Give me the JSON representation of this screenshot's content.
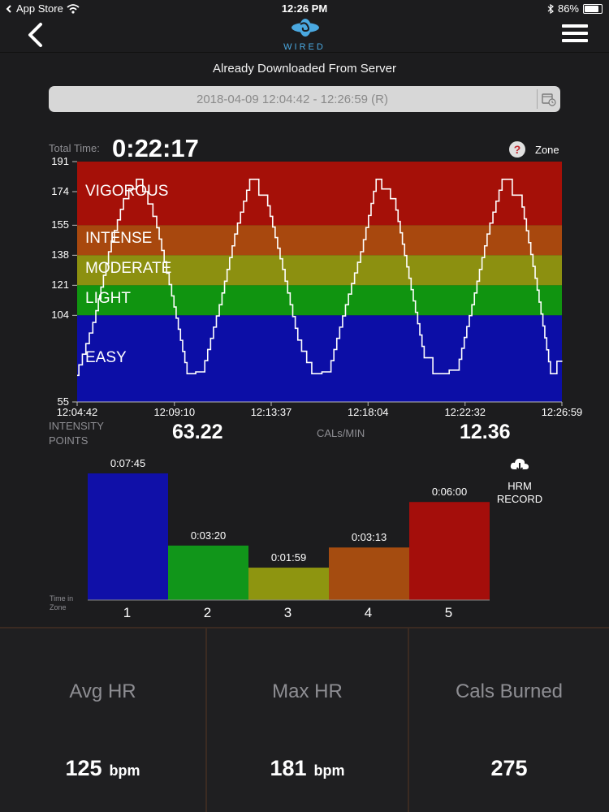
{
  "status_bar": {
    "back_app": "App Store",
    "time": "12:26 PM",
    "battery": "86%",
    "battery_level": 0.86
  },
  "nav": {
    "logo_text": "WIRED"
  },
  "session": {
    "source_note": "Already Downloaded From Server",
    "range": "2018-04-09 12:04:42 - 12:26:59 (R)",
    "total_time_label": "Total Time:",
    "total_time": "0:22:17",
    "zone_label": "Zone",
    "help_glyph": "?"
  },
  "chart_data": [
    {
      "type": "line",
      "title": "",
      "ylabel": "",
      "xlabel": "",
      "ylim": [
        55,
        191
      ],
      "y_ticks": [
        "191",
        "174",
        "155",
        "138",
        "121",
        "104",
        "55"
      ],
      "x_ticks": [
        "12:04:42",
        "12:09:10",
        "12:13:37",
        "12:18:04",
        "12:22:32",
        "12:26:59"
      ],
      "zones": [
        {
          "name": "VIGOROUS",
          "from": 155,
          "to": 191,
          "color": "#a51008"
        },
        {
          "name": "INTENSE",
          "from": 138,
          "to": 155,
          "color": "#a8480e"
        },
        {
          "name": "MODERATE",
          "from": 121,
          "to": 138,
          "color": "#8c9010"
        },
        {
          "name": "LIGHT",
          "from": 104,
          "to": 121,
          "color": "#109410"
        },
        {
          "name": "EASY",
          "from": 55,
          "to": 104,
          "color": "#0c0ea6"
        }
      ],
      "series": [
        {
          "color": "#ffffff",
          "x_minutes": [
            0,
            0.8,
            1.5,
            2.2,
            2.9,
            3.6,
            4.4,
            5.1,
            5.8,
            6.6,
            7.3,
            8.0,
            8.7,
            9.5,
            10.2,
            10.9,
            11.6,
            12.4,
            13.1,
            13.8,
            14.6,
            15.3,
            16.0,
            16.7,
            17.5,
            18.2,
            18.9,
            19.6,
            20.4,
            21.1,
            21.8,
            22.3
          ],
          "values": [
            70,
            100,
            140,
            170,
            181,
            160,
            115,
            71,
            72,
            110,
            150,
            181,
            172,
            130,
            90,
            71,
            72,
            110,
            140,
            181,
            170,
            125,
            80,
            71,
            73,
            110,
            150,
            181,
            172,
            125,
            71,
            78
          ]
        }
      ]
    },
    {
      "type": "bar",
      "title": "",
      "xlabel": "",
      "ylabel": "Time in Zone",
      "categories": [
        "1",
        "2",
        "3",
        "4",
        "5"
      ],
      "value_labels": [
        "0:07:45",
        "0:03:20",
        "0:01:59",
        "0:03:13",
        "0:06:00"
      ],
      "values": [
        465,
        200,
        119,
        193,
        360
      ],
      "colors": [
        "#1010a8",
        "#11961a",
        "#8e9510",
        "#a54c10",
        "#a40e0b"
      ]
    }
  ],
  "metrics": {
    "intensity_label_1": "INTENSITY",
    "intensity_label_2": "POINTS",
    "intensity_value": "63.22",
    "cals_label": "CALs/MIN",
    "cals_value": "12.36"
  },
  "hrm": {
    "line1": "HRM",
    "line2": "RECORD"
  },
  "stats": [
    {
      "title": "Avg HR",
      "value": "125",
      "unit": "bpm"
    },
    {
      "title": "Max HR",
      "value": "181",
      "unit": "bpm"
    },
    {
      "title": "Cals Burned",
      "value": "275",
      "unit": ""
    }
  ],
  "colors": {
    "accent": "#4aa8e0",
    "background": "#1c1c1e"
  }
}
